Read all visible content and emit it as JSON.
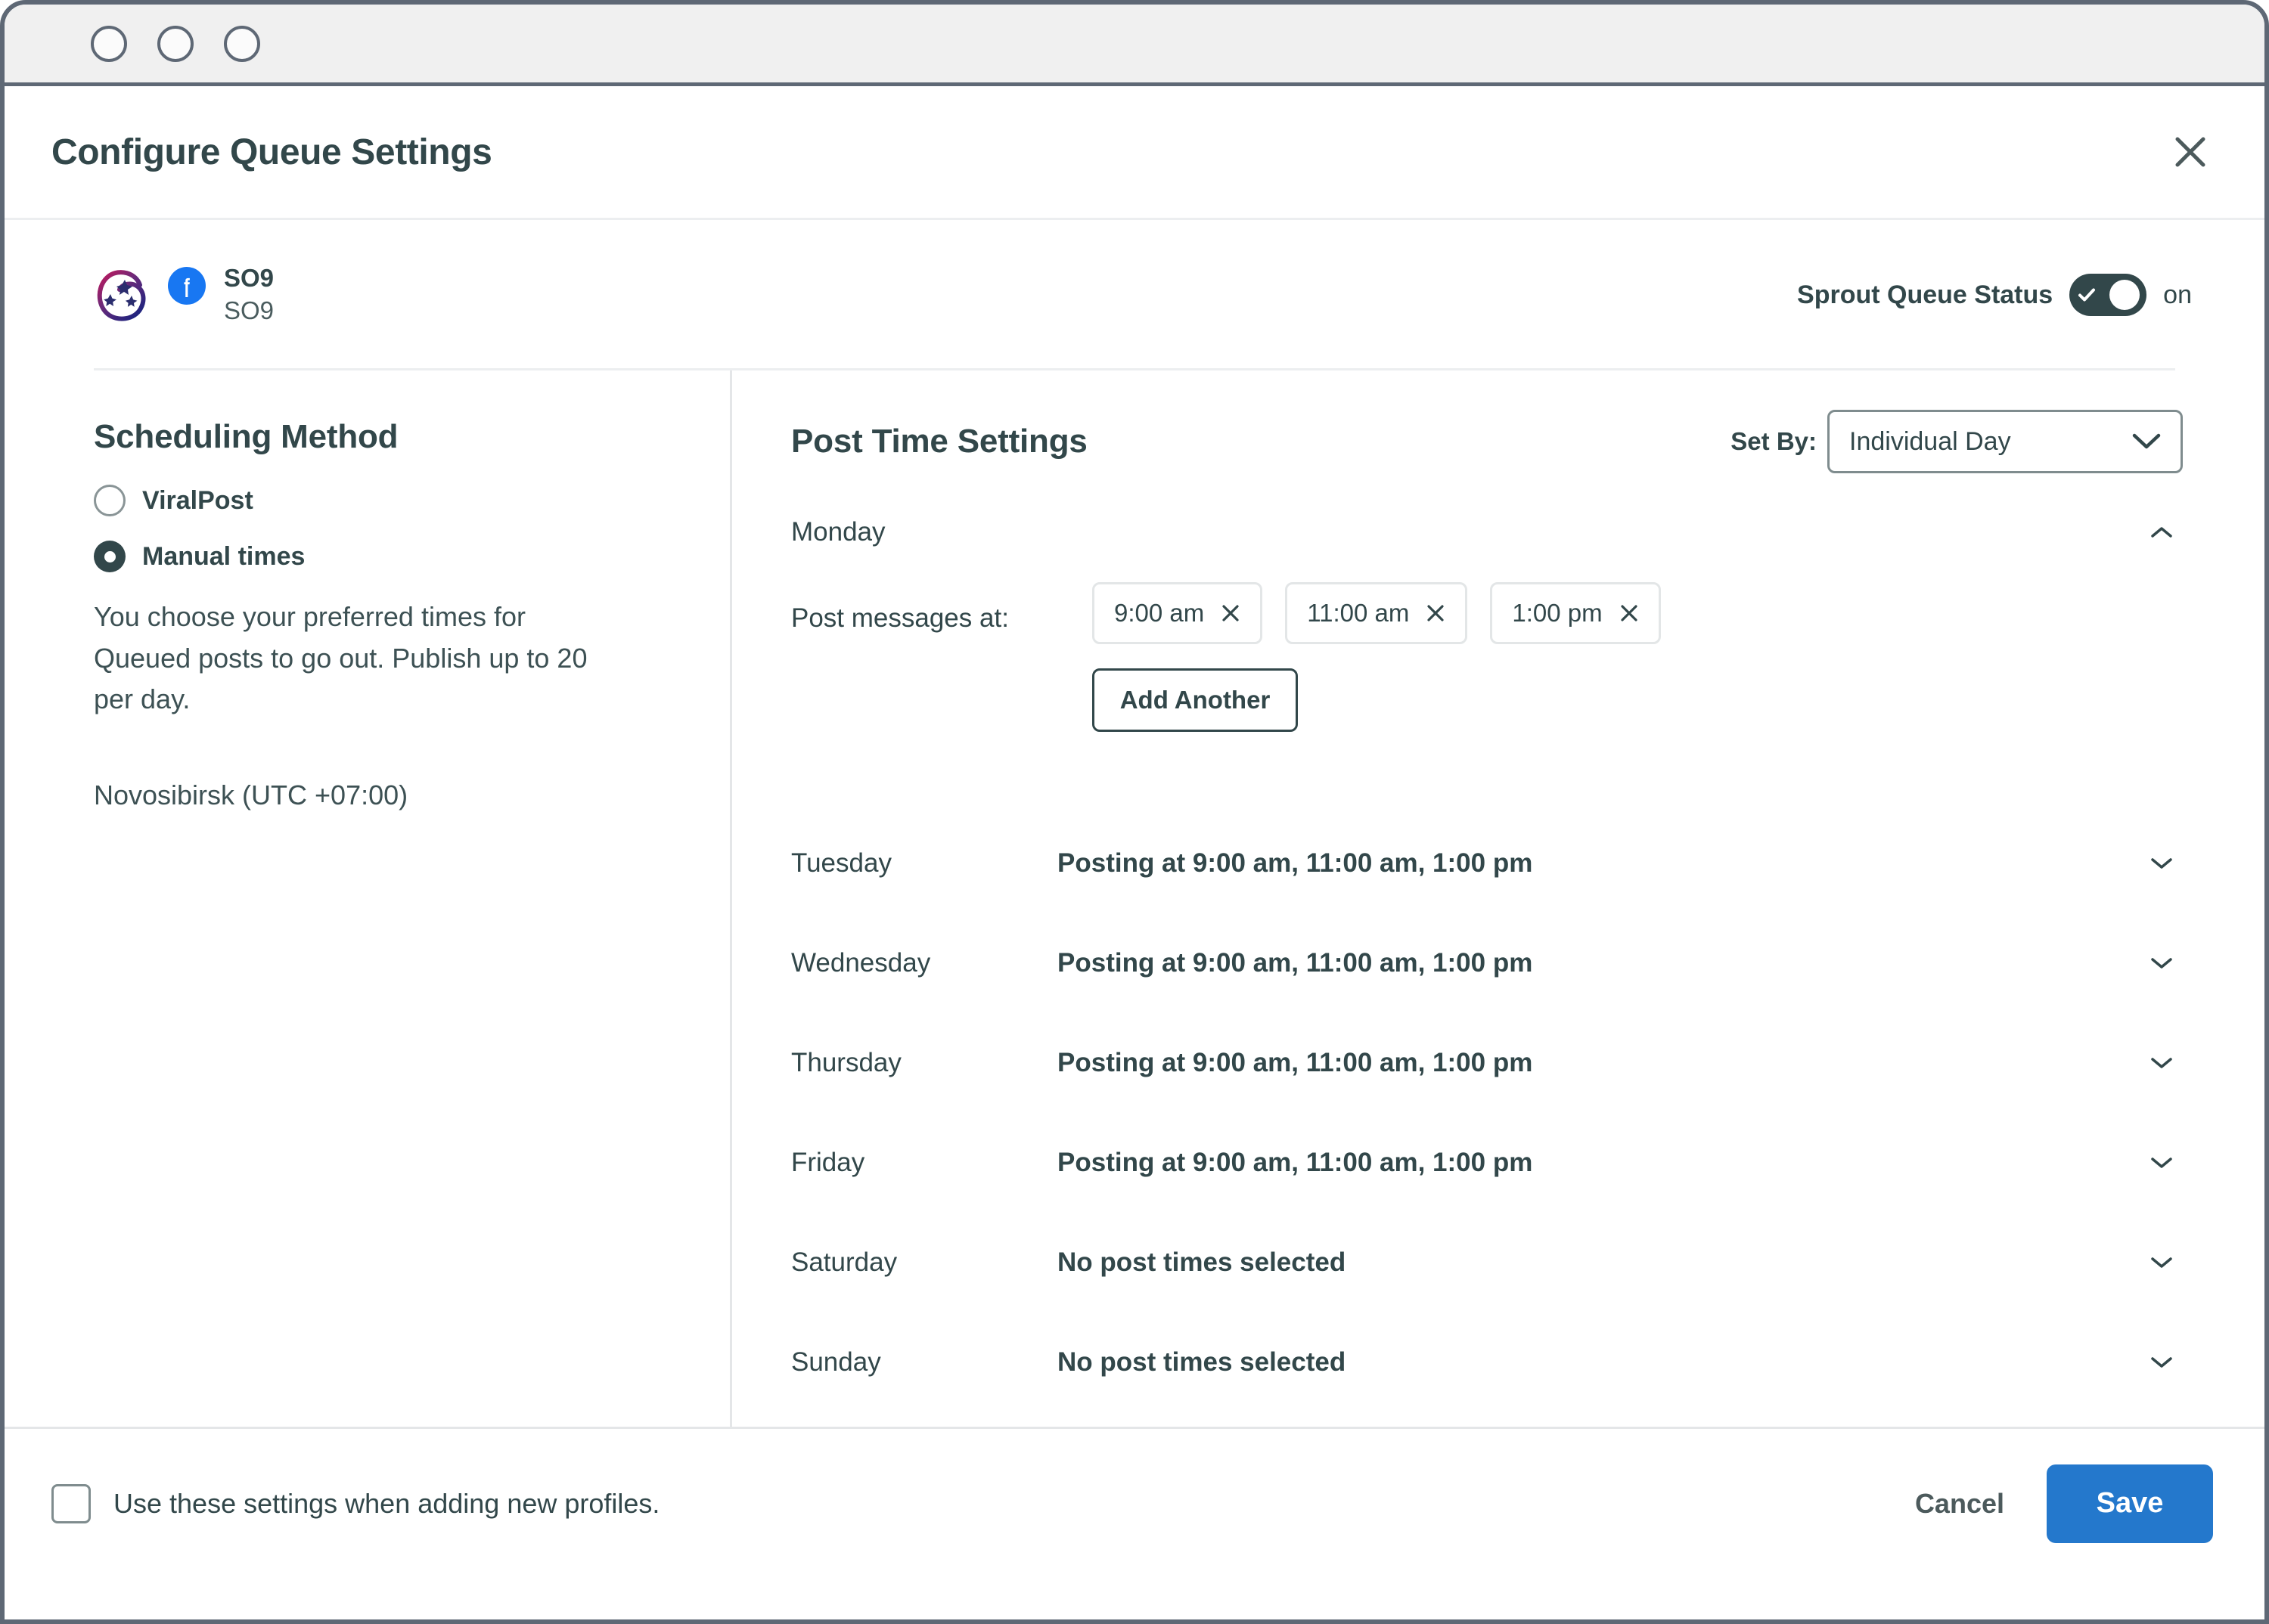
{
  "window": {
    "controls": [
      "window-dot-1",
      "window-dot-2",
      "window-dot-3"
    ]
  },
  "modal": {
    "title": "Configure Queue Settings",
    "close_icon": "close-icon"
  },
  "profile": {
    "avatar_icon": "profile-avatar-swirl-icon",
    "network_icon": "facebook-icon",
    "name": "SO9",
    "handle": "SO9"
  },
  "queue_status": {
    "label": "Sprout Queue Status",
    "toggle_on": true,
    "toggle_icon": "check-icon",
    "value": "on"
  },
  "scheduling_method": {
    "title": "Scheduling Method",
    "options": [
      {
        "label": "ViralPost",
        "selected": false
      },
      {
        "label": "Manual times",
        "selected": true
      }
    ],
    "description": "You choose your preferred times for Queued posts to go out. Publish up to 20 per day.",
    "timezone": "Novosibirsk (UTC +07:00)"
  },
  "post_time_settings": {
    "title": "Post Time Settings",
    "set_by_label": "Set By:",
    "set_by_value": "Individual Day",
    "set_by_chevron_icon": "chevron-down-icon",
    "expanded_day": {
      "name": "Monday",
      "collapse_icon": "chevron-up-icon",
      "times_label": "Post messages at:",
      "times": [
        {
          "value": "9:00 am",
          "remove_icon": "close-icon"
        },
        {
          "value": "11:00 am",
          "remove_icon": "close-icon"
        },
        {
          "value": "1:00 pm",
          "remove_icon": "close-icon"
        }
      ],
      "add_another_label": "Add Another"
    },
    "days": [
      {
        "name": "Tuesday",
        "summary": "Posting at 9:00 am, 11:00 am, 1:00 pm",
        "expand_icon": "chevron-down-icon"
      },
      {
        "name": "Wednesday",
        "summary": "Posting at 9:00 am, 11:00 am, 1:00 pm",
        "expand_icon": "chevron-down-icon"
      },
      {
        "name": "Thursday",
        "summary": "Posting at 9:00 am, 11:00 am, 1:00 pm",
        "expand_icon": "chevron-down-icon"
      },
      {
        "name": "Friday",
        "summary": "Posting at 9:00 am, 11:00 am, 1:00 pm",
        "expand_icon": "chevron-down-icon"
      },
      {
        "name": "Saturday",
        "summary": "No post times selected",
        "expand_icon": "chevron-down-icon"
      },
      {
        "name": "Sunday",
        "summary": "No post times selected",
        "expand_icon": "chevron-down-icon"
      }
    ]
  },
  "footer": {
    "checkbox_label": "Use these settings when adding new profiles.",
    "checkbox_checked": false,
    "cancel_label": "Cancel",
    "save_label": "Save"
  },
  "colors": {
    "text_primary": "#32474a",
    "accent_blue": "#2478CC",
    "facebook_blue": "#1877F2",
    "toggle_on": "#32474a",
    "border_light": "#e4e6e8"
  }
}
